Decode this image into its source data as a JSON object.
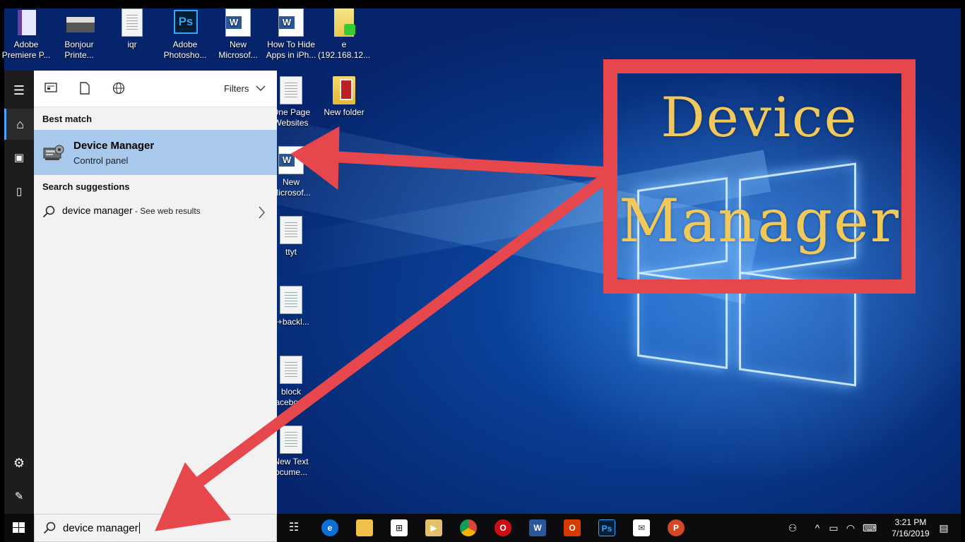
{
  "desktop": {
    "top_icons": [
      {
        "label": "Adobe Premiere P...",
        "icon": "premiere-icon"
      },
      {
        "label": "Bonjour Printe...",
        "icon": "printer-icon"
      },
      {
        "label": "iqr",
        "icon": "document-icon"
      },
      {
        "label": "Adobe Photosho...",
        "icon": "photoshop-icon"
      },
      {
        "label": "New Microsof...",
        "icon": "word-icon"
      },
      {
        "label": "How To Hide Apps in iPh...",
        "icon": "word-icon"
      },
      {
        "label": "e (192.168.12...",
        "icon": "network-folder-icon"
      }
    ],
    "column_icons": [
      {
        "label": "One Page Websites",
        "icon": "document-icon"
      },
      {
        "label": "New folder",
        "icon": "folder-icon"
      },
      {
        "label": "New Microsof...",
        "icon": "word-icon"
      },
      {
        "label": "ttyt",
        "icon": "document-icon"
      },
      {
        "label": "o+backl...",
        "icon": "document-icon"
      },
      {
        "label": "block acebook",
        "icon": "document-icon"
      },
      {
        "label": "New Text ocume...",
        "icon": "document-icon"
      }
    ]
  },
  "start_menu": {
    "filters_label": "Filters",
    "best_match_heading": "Best match",
    "best_match": {
      "title": "Device Manager",
      "subtitle": "Control panel"
    },
    "suggestions_heading": "Search suggestions",
    "suggestion": {
      "query": "device manager",
      "hint": " - See web results"
    }
  },
  "taskbar": {
    "search_value": "device manager",
    "time": "3:21 PM",
    "date": "7/16/2019"
  },
  "annotation": {
    "line1": "Device",
    "line2": "Manager",
    "color": "#e6474d",
    "text_color": "#f1c95a"
  }
}
